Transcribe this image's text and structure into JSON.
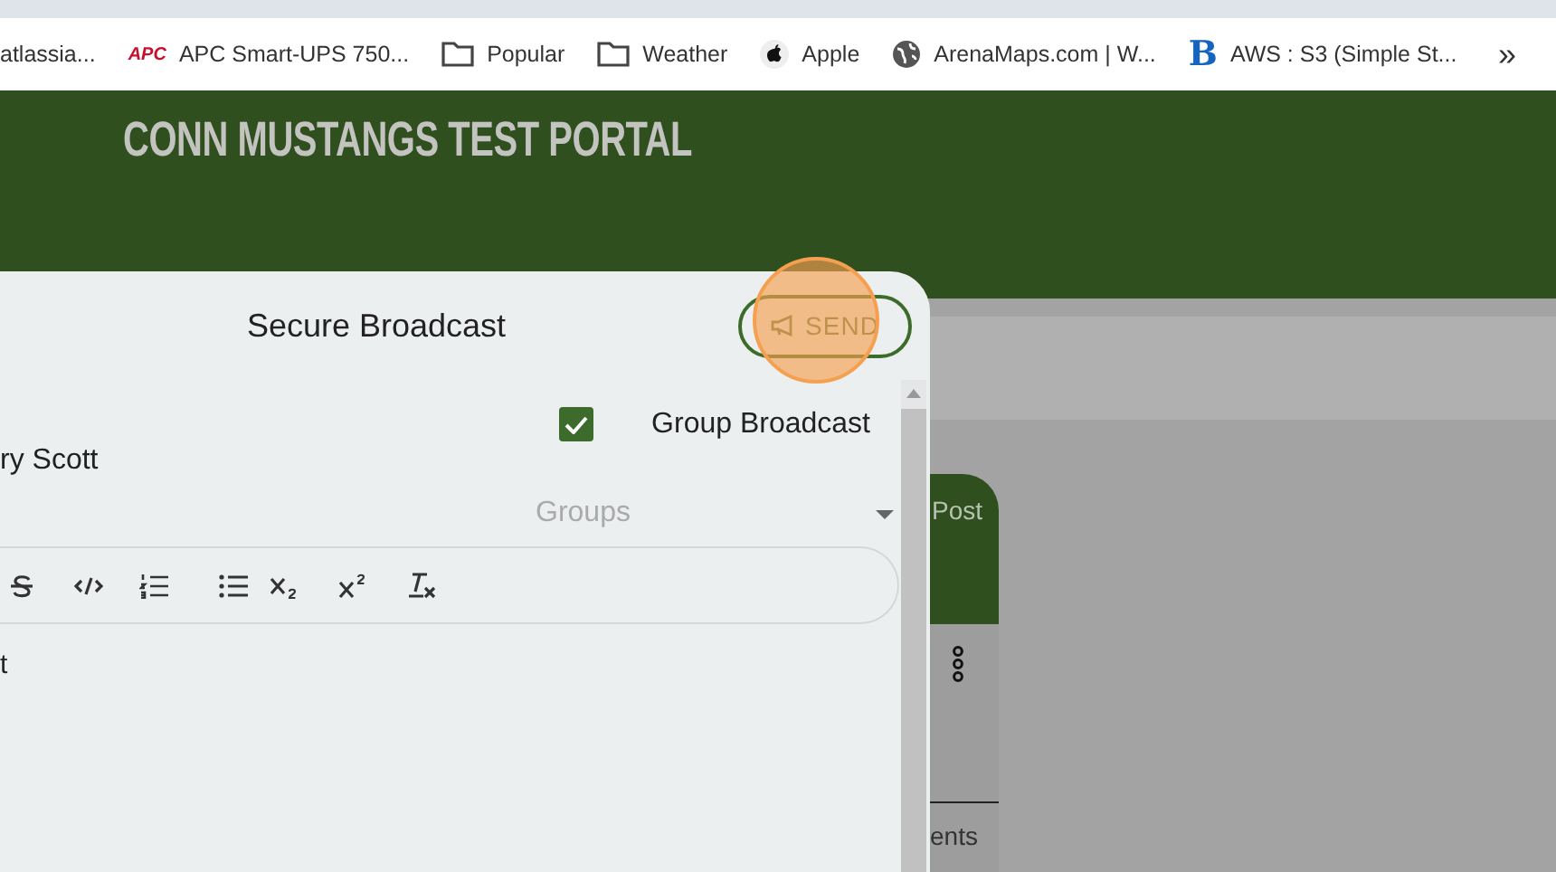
{
  "bookmarks": [
    {
      "kind": "page",
      "label": "atlassia..."
    },
    {
      "kind": "logo",
      "logo": "APC",
      "label": "APC Smart-UPS 750..."
    },
    {
      "kind": "folder",
      "label": "Popular"
    },
    {
      "kind": "folder",
      "label": "Weather"
    },
    {
      "kind": "apple",
      "label": "Apple"
    },
    {
      "kind": "globe",
      "label": "ArenaMaps.com | W..."
    },
    {
      "kind": "letter",
      "logo": "B",
      "label": "AWS : S3 (Simple St..."
    }
  ],
  "bookmarks_more": "»",
  "header": {
    "title": "CONN MUSTANGS TEST PORTAL"
  },
  "background": {
    "tab_label": "Post",
    "bottom_label": "ents"
  },
  "dialog": {
    "title": "Secure Broadcast",
    "send_button": "SEND",
    "group_broadcast": {
      "label": "Group Broadcast",
      "checked": true
    },
    "recipient": "ry Scott",
    "groups": {
      "placeholder": "Groups"
    },
    "toolbar": [
      {
        "kind": "strike"
      },
      {
        "kind": "code"
      },
      {
        "kind": "ordered-list"
      },
      {
        "kind": "bullet-list"
      },
      {
        "kind": "subscript"
      },
      {
        "kind": "superscript"
      },
      {
        "kind": "clear-format"
      }
    ],
    "editor_text": "t"
  }
}
